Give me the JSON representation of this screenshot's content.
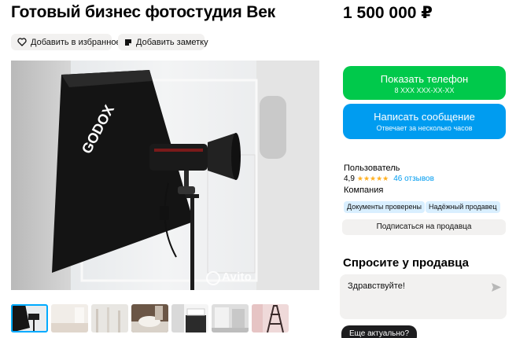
{
  "listing": {
    "title": "Готовый бизнес фотостудия Век",
    "price": "1 500 000 ₽",
    "add_favorite": "Добавить в избранное",
    "add_note": "Добавить заметку",
    "watermark": "Avito",
    "photo_brand": "GODOX",
    "thumbnail_count": 7
  },
  "contact": {
    "show_phone": "Показать телефон",
    "phone_masked": "8 XXX XXX-XX-XX",
    "write_message": "Написать сообщение",
    "reply_time": "Отвечает за несколько часов"
  },
  "seller": {
    "name": "Пользователь",
    "rating": "4,9",
    "stars": "★★★★★",
    "reviews": "46 отзывов",
    "type": "Компания",
    "badges": [
      "Документы проверены",
      "Надёжный продавец"
    ],
    "subscribe": "Подписаться на продавца"
  },
  "ask": {
    "title": "Спросите у продавца",
    "message": "Здравствуйте!",
    "quick_reply": "Еще актуально?"
  },
  "colors": {
    "phone_button": "#00c94b",
    "message_button": "#009cf0",
    "badge_bg": "#d9efff",
    "star": "#ffb021",
    "quick_reply_bg": "#1d1d1f"
  }
}
